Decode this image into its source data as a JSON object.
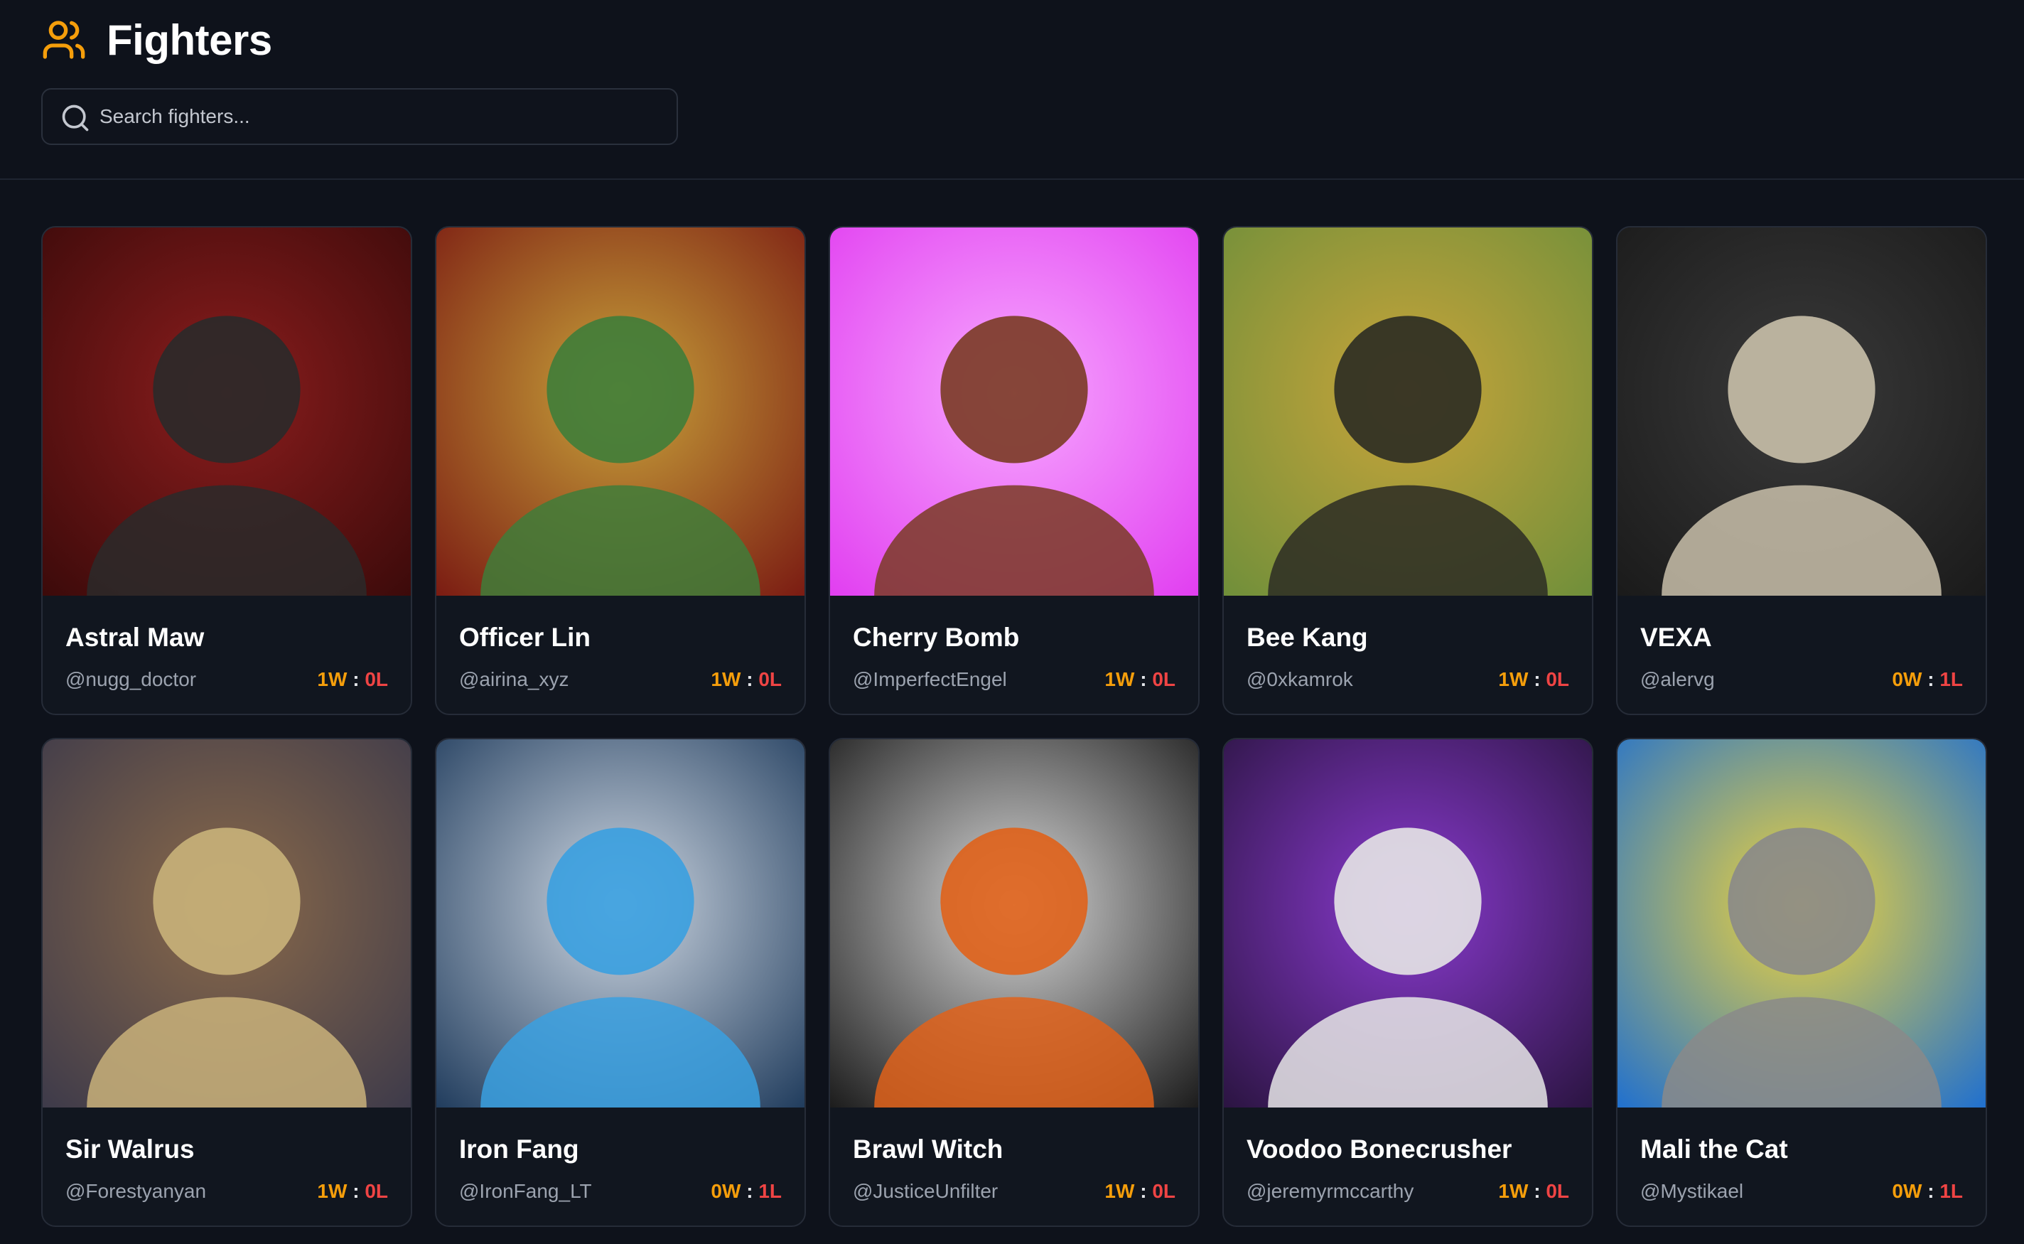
{
  "header": {
    "title": "Fighters",
    "icon": "users-icon",
    "search_placeholder": "Search fighters...",
    "search_value": ""
  },
  "colors": {
    "background": "#0e121b",
    "card": "#11161f",
    "accent": "#f59e0b",
    "loss": "#ef4444"
  },
  "fighters": [
    {
      "name": "Astral Maw",
      "handle": "@nugg_doctor",
      "wins": "1W",
      "losses": "0L",
      "art_colors": [
        "#3b0a0a",
        "#8b1d1d",
        "#2a2a2a"
      ]
    },
    {
      "name": "Officer Lin",
      "handle": "@airina_xyz",
      "wins": "1W",
      "losses": "0L",
      "art_colors": [
        "#7a1a12",
        "#c8a33a",
        "#3f7d3a"
      ]
    },
    {
      "name": "Cherry Bomb",
      "handle": "@ImperfectEngel",
      "wins": "1W",
      "losses": "0L",
      "art_colors": [
        "#e13df0",
        "#f7a8ff",
        "#7a3b23"
      ]
    },
    {
      "name": "Bee Kang",
      "handle": "@0xkamrok",
      "wins": "1W",
      "losses": "0L",
      "art_colors": [
        "#6f8f3a",
        "#c9a43a",
        "#2b2b24"
      ]
    },
    {
      "name": "VEXA",
      "handle": "@alervg",
      "wins": "0W",
      "losses": "1L",
      "art_colors": [
        "#1a1a1a",
        "#3a3a3a",
        "#c9c0aa"
      ]
    },
    {
      "name": "Sir Walrus",
      "handle": "@Forestyanyan",
      "wins": "1W",
      "losses": "0L",
      "art_colors": [
        "#3d3a4a",
        "#8b6a4a",
        "#c9b27a"
      ]
    },
    {
      "name": "Iron Fang",
      "handle": "@IronFang_LT",
      "wins": "0W",
      "losses": "1L",
      "art_colors": [
        "#1f3b5c",
        "#cfd8e3",
        "#3aa0e0"
      ]
    },
    {
      "name": "Brawl Witch",
      "handle": "@JusticeUnfilter",
      "wins": "1W",
      "losses": "0L",
      "art_colors": [
        "#1a1a1a",
        "#d9d9d9",
        "#e0621a"
      ]
    },
    {
      "name": "Voodoo Bonecrusher",
      "handle": "@jeremyrmccarthy",
      "wins": "1W",
      "losses": "0L",
      "art_colors": [
        "#2a1440",
        "#8a3ad0",
        "#e6e6e6"
      ]
    },
    {
      "name": "Mali the Cat",
      "handle": "@Mystikael",
      "wins": "0W",
      "losses": "1L",
      "art_colors": [
        "#1e6fd0",
        "#f2d53a",
        "#8a8a8a"
      ]
    }
  ]
}
